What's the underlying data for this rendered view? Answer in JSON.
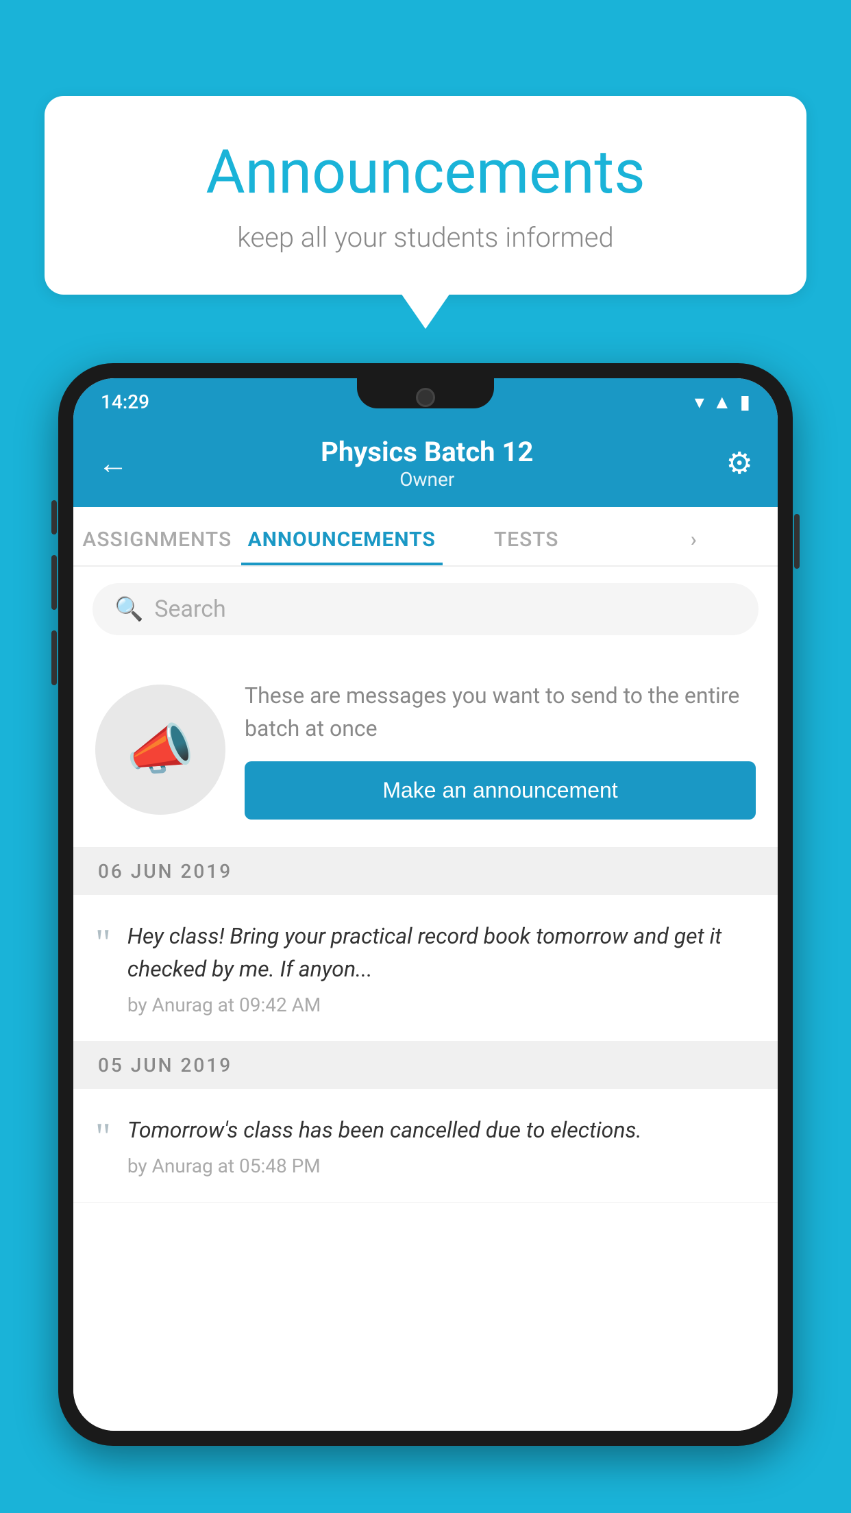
{
  "page": {
    "background_color": "#1ab3d8"
  },
  "speech_bubble": {
    "title": "Announcements",
    "subtitle": "keep all your students informed"
  },
  "phone": {
    "status_bar": {
      "time": "14:29",
      "wifi": "▾",
      "signal": "▲",
      "battery": "▮"
    },
    "header": {
      "back_label": "←",
      "title": "Physics Batch 12",
      "subtitle": "Owner",
      "gear_label": "⚙"
    },
    "tabs": [
      {
        "label": "ASSIGNMENTS",
        "active": false
      },
      {
        "label": "ANNOUNCEMENTS",
        "active": true
      },
      {
        "label": "TESTS",
        "active": false
      },
      {
        "label": "›",
        "active": false
      }
    ],
    "search": {
      "placeholder": "Search"
    },
    "intro": {
      "description": "These are messages you want to send to the entire batch at once",
      "button_label": "Make an announcement"
    },
    "announcements": [
      {
        "date": "06  JUN  2019",
        "text": "Hey class! Bring your practical record book tomorrow and get it checked by me. If anyon...",
        "meta": "by Anurag at 09:42 AM"
      },
      {
        "date": "05  JUN  2019",
        "text": "Tomorrow's class has been cancelled due to elections.",
        "meta": "by Anurag at 05:48 PM"
      }
    ]
  }
}
